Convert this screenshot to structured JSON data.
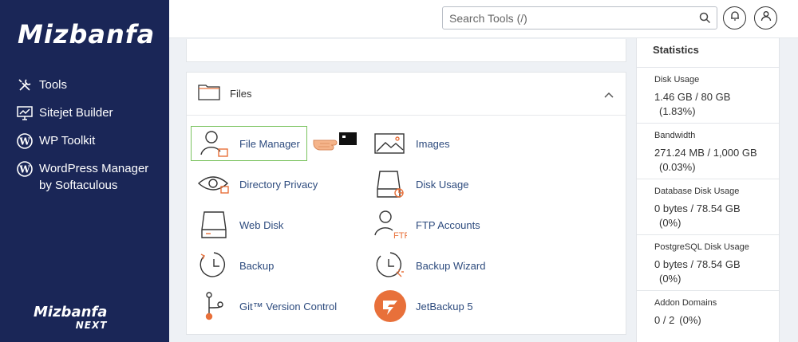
{
  "sidebar": {
    "logo": "Mizbanfa",
    "items": [
      {
        "label": "Tools"
      },
      {
        "label": "Sitejet Builder"
      },
      {
        "label": "WP Toolkit"
      },
      {
        "label": "WordPress Manager by Softaculous"
      }
    ],
    "brand_line1": "Mizbanfa",
    "brand_line2": "NEXT"
  },
  "header": {
    "search_placeholder": "Search Tools (/)"
  },
  "files": {
    "title": "Files",
    "tools": [
      {
        "label": "File Manager",
        "icon": "file-manager-icon"
      },
      {
        "label": "Images",
        "icon": "images-icon"
      },
      {
        "label": "Directory Privacy",
        "icon": "eye-folder-icon"
      },
      {
        "label": "Disk Usage",
        "icon": "disk-usage-icon"
      },
      {
        "label": "Web Disk",
        "icon": "web-disk-icon"
      },
      {
        "label": "FTP Accounts",
        "icon": "ftp-accounts-icon"
      },
      {
        "label": "Backup",
        "icon": "backup-icon"
      },
      {
        "label": "Backup Wizard",
        "icon": "backup-wizard-icon"
      },
      {
        "label": "Git™ Version Control",
        "icon": "git-icon"
      },
      {
        "label": "JetBackup 5",
        "icon": "jetbackup-icon"
      }
    ]
  },
  "stats": {
    "title": "Statistics",
    "items": [
      {
        "label": "Disk Usage",
        "value": "1.46 GB / 80 GB",
        "percent": "(1.83%)"
      },
      {
        "label": "Bandwidth",
        "value": "271.24 MB / 1,000 GB",
        "percent": "(0.03%)"
      },
      {
        "label": "Database Disk Usage",
        "value": "0 bytes / 78.54 GB",
        "percent": "(0%)"
      },
      {
        "label": "PostgreSQL Disk Usage",
        "value": "0 bytes / 78.54 GB",
        "percent": "(0%)"
      },
      {
        "label": "Addon Domains",
        "value": "0 / 2",
        "percent": "(0%)"
      }
    ]
  },
  "colors": {
    "sidebar_bg": "#1a2657",
    "link": "#2c4a7d",
    "highlight": "#7ac35f",
    "accent_orange": "#e8703a"
  }
}
